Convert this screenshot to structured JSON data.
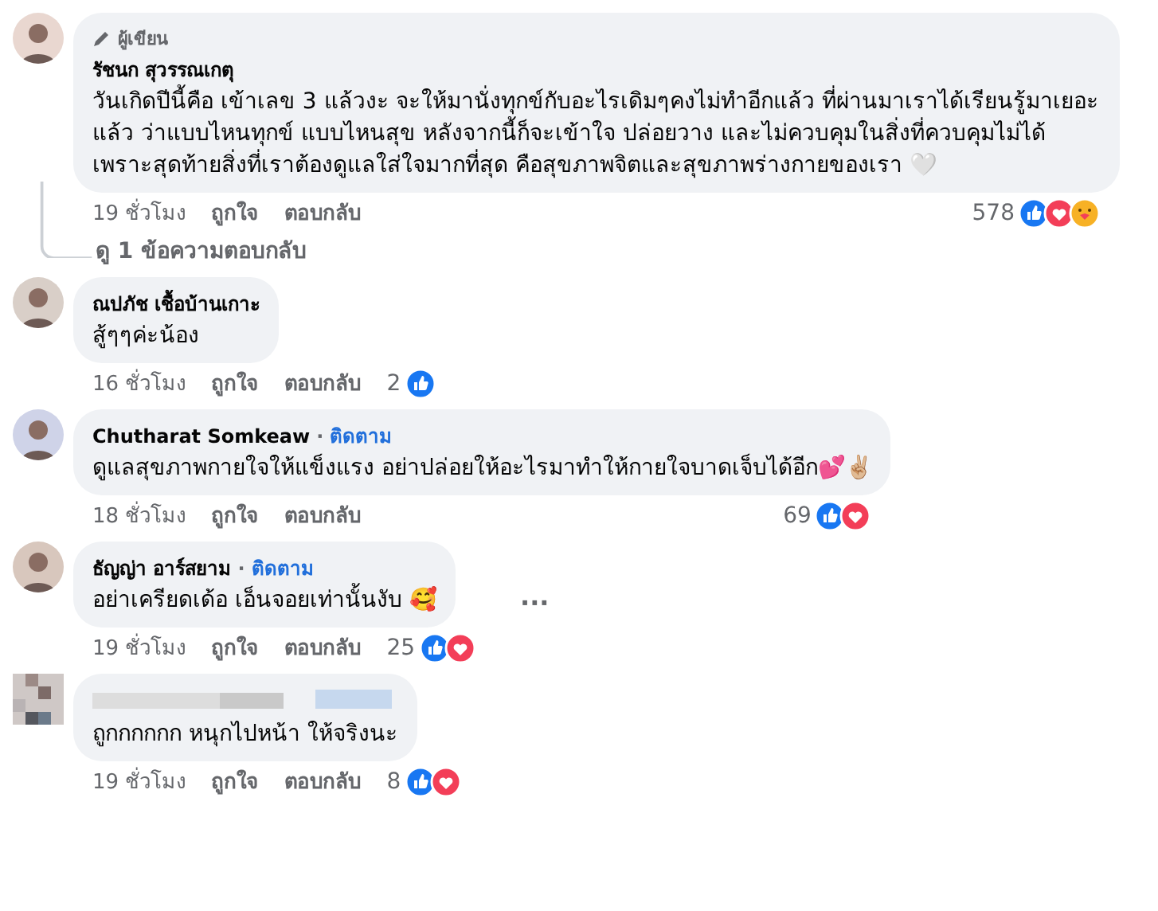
{
  "comments": [
    {
      "author_badge": "ผู้เขียน",
      "name": "รัชนก สุวรรณเกตุ",
      "text": "วันเกิดปีนี้คือ เข้าเลข 3 แล้วงะ จะให้มานั่งทุกข์กับอะไรเดิมๆคงไม่ทำอีกแล้ว ที่ผ่านมาเราได้เรียนรู้มาเยอะแล้ว ว่าแบบไหนทุกข์ แบบไหนสุข หลังจากนี้ก็จะเข้าใจ ปล่อยวาง และไม่ควบคุมในสิ่งที่ควบคุมไม่ได้ เพราะสุดท้ายสิ่งที่เราต้องดูแลใส่ใจมากที่สุด คือสุขภาพจิตและสุขภาพร่างกายของเรา 🤍",
      "time": "19 ชั่วโมง",
      "like": "ถูกใจ",
      "reply": "ตอบกลับ",
      "reaction_count": "578",
      "reactions": [
        {
          "kind": "like"
        },
        {
          "kind": "love"
        },
        {
          "kind": "care"
        }
      ],
      "view_replies": "ดู 1 ข้อความตอบกลับ"
    },
    {
      "name": "ณปภัช เชื้อบ้านเกาะ",
      "text": "สู้ๆๆค่ะน้อง",
      "time": "16 ชั่วโมง",
      "like": "ถูกใจ",
      "reply": "ตอบกลับ",
      "reaction_count": "2",
      "reactions": [
        {
          "kind": "like"
        }
      ]
    },
    {
      "name": "Chutharat Somkeaw",
      "separator": "·",
      "follow": "ติดตาม",
      "text": "ดูแลสุขภาพกายใจให้แข็งแรง อย่าปล่อยให้อะไรมาทำให้กายใจบาดเจ็บได้อีก💕✌🏼",
      "time": "18 ชั่วโมง",
      "like": "ถูกใจ",
      "reply": "ตอบกลับ",
      "reaction_count": "69",
      "reactions": [
        {
          "kind": "like"
        },
        {
          "kind": "love"
        }
      ]
    },
    {
      "name": "ธัญญ่า อาร์สยาม",
      "separator": "·",
      "follow": "ติดตาม",
      "text": "อย่าเครียดเด้อ เอ็นจอยเท่านั้นงับ 🥰",
      "time": "19 ชั่วโมง",
      "like": "ถูกใจ",
      "reply": "ตอบกลับ",
      "reaction_count": "25",
      "reactions": [
        {
          "kind": "like"
        },
        {
          "kind": "love"
        }
      ],
      "more": "···"
    },
    {
      "name_hidden": true,
      "text": "ถูกกกกกก หนุกไปหน้า ให้จริงนะ",
      "time": "19 ชั่วโมง",
      "like": "ถูกใจ",
      "reply": "ตอบกลับ",
      "reaction_count": "8",
      "reactions": [
        {
          "kind": "like"
        },
        {
          "kind": "love"
        }
      ]
    }
  ]
}
